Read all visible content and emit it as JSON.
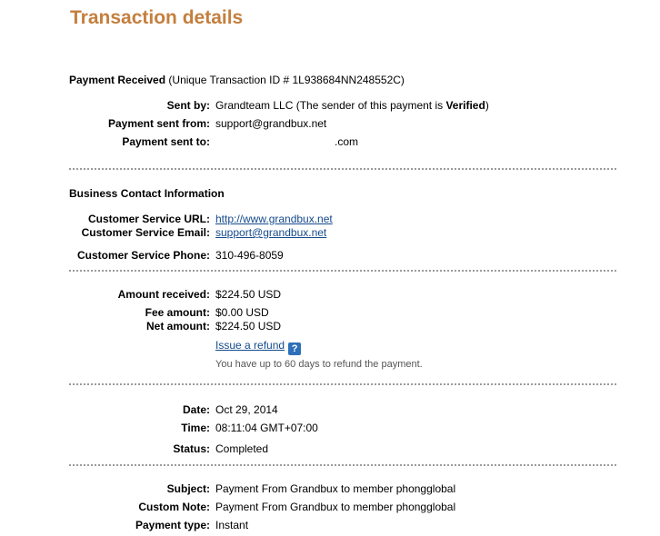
{
  "title": "Transaction details",
  "payment": {
    "heading": "Payment Received",
    "id_text": "(Unique Transaction ID # 1L938684NN248552C)",
    "sent_by_label": "Sent by:",
    "sent_by_value": "Grandteam LLC (The sender of this payment is ",
    "sent_by_verified": "Verified",
    "sent_by_close": ")",
    "sent_from_label": "Payment sent from:",
    "sent_from_value": "support@grandbux.net",
    "sent_to_label": "Payment sent to:",
    "sent_to_value": ".com"
  },
  "contact": {
    "heading": "Business Contact Information",
    "url_label": "Customer Service URL:",
    "url_value": "http://www.grandbux.net",
    "email_label": "Customer Service Email:",
    "email_value": "support@grandbux.net",
    "phone_label": "Customer Service Phone:",
    "phone_value": "310-496-8059"
  },
  "amounts": {
    "received_label": "Amount received:",
    "received_value": "$224.50 USD",
    "fee_label": "Fee amount:",
    "fee_value": "$0.00 USD",
    "net_label": "Net amount:",
    "net_value": "$224.50 USD",
    "refund_link": "Issue a refund",
    "help_icon_glyph": "?",
    "refund_note": "You have up to 60 days to refund the payment."
  },
  "status": {
    "date_label": "Date:",
    "date_value": "Oct 29, 2014",
    "time_label": "Time:",
    "time_value": "08:11:04 GMT+07:00",
    "status_label": "Status:",
    "status_value": "Completed"
  },
  "details": {
    "subject_label": "Subject:",
    "subject_value": "Payment From Grandbux to member phongglobal",
    "note_label": "Custom Note:",
    "note_value": "Payment From Grandbux to member phongglobal",
    "type_label": "Payment type:",
    "type_value": "Instant"
  },
  "colors": {
    "title": "#c47f3d",
    "link": "#144a8c",
    "help_icon": "#2d6fb8"
  }
}
